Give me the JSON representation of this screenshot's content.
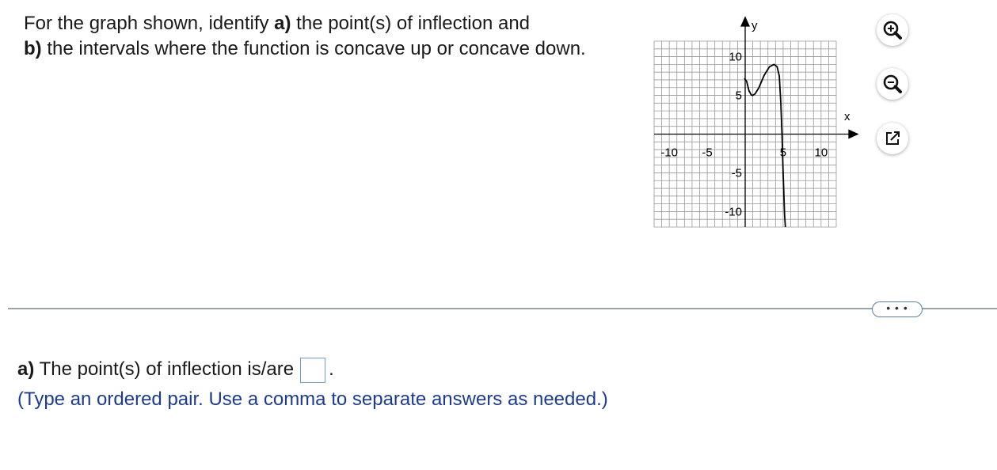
{
  "question": {
    "text_1": "For the graph shown, identify ",
    "bold_a": "a)",
    "text_2": " the point(s) of inflection and",
    "bold_b": "b)",
    "text_3": " the intervals where the function is concave up or concave down."
  },
  "graph": {
    "x_axis_label": "x",
    "y_axis_label": "y",
    "x_tick_labels": [
      "-10",
      "-5",
      "5",
      "10"
    ],
    "y_tick_labels": [
      "10",
      "5",
      "-5",
      "-10"
    ],
    "curve_color": "#000000",
    "grid_color": "#9a9a9a"
  },
  "tools": {
    "zoom_in": "zoom-in-icon",
    "zoom_out": "zoom-out-icon",
    "popout": "popout-icon"
  },
  "more_button_label": "• • •",
  "answer": {
    "bold_label": "a)",
    "prompt": " The point(s) of inflection is/are",
    "input_value": "",
    "end_punct": ".",
    "hint": "(Type an ordered pair. Use a comma to separate answers as needed.)"
  }
}
